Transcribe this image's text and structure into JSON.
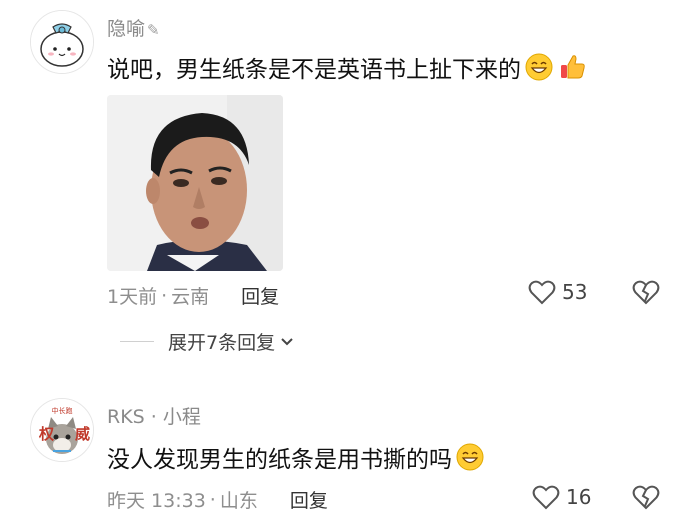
{
  "comments": [
    {
      "username": "隐喻",
      "edit_icon": "✎",
      "text": "说吧，男生纸条是不是英语书上扯下来的",
      "emojis": [
        "grin-emoji",
        "thumbs-up-emoji"
      ],
      "time": "1天前",
      "separator": "·",
      "location": "云南",
      "reply_label": "回复",
      "likes": "53",
      "expand_label": "展开7条回复"
    },
    {
      "username": "RKS · 小程",
      "text": "没人发现男生的纸条是用书撕的吗",
      "emojis": [
        "grin-emoji"
      ],
      "time": "昨天 13:33",
      "separator": "·",
      "location": "山东",
      "reply_label": "回复",
      "likes": "16",
      "avatar_text_top": "中长跑",
      "avatar_text_left": "权",
      "avatar_text_right": "威"
    }
  ],
  "colors": {
    "meta": "#8e8e8e",
    "text": "#111111",
    "emoji_yellow": "#ffcc33",
    "thumb_red": "#f04848"
  }
}
